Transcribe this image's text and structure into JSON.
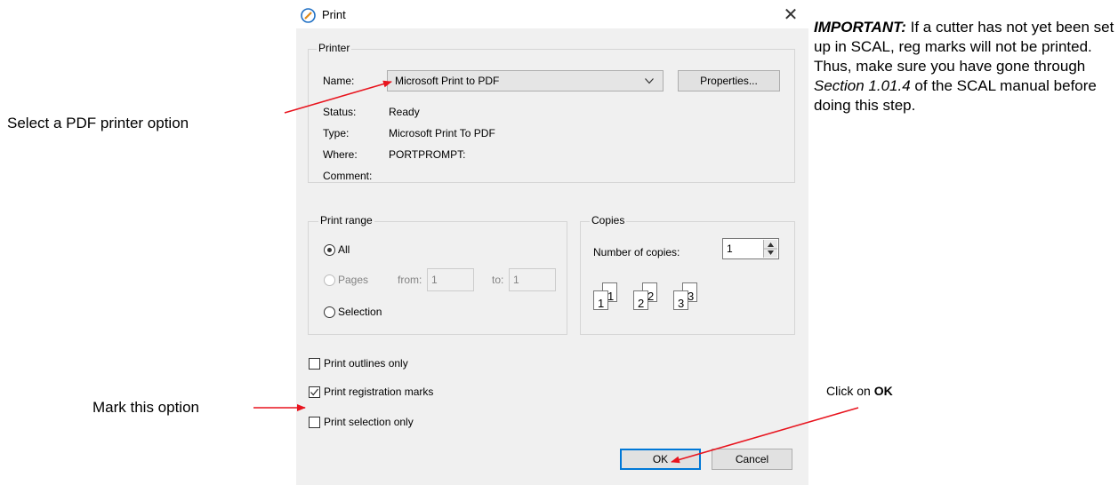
{
  "dialog": {
    "title": "Print",
    "close_glyph": "✕",
    "printer_group": {
      "label": "Printer",
      "name_label": "Name:",
      "name_value": "Microsoft Print to PDF",
      "properties_button": "Properties...",
      "status_label": "Status:",
      "status_value": "Ready",
      "type_label": "Type:",
      "type_value": "Microsoft Print To PDF",
      "where_label": "Where:",
      "where_value": "PORTPROMPT:",
      "comment_label": "Comment:"
    },
    "print_range": {
      "label": "Print range",
      "all": "All",
      "pages": "Pages",
      "from_label": "from:",
      "from_value": "1",
      "to_label": "to:",
      "to_value": "1",
      "selection": "Selection"
    },
    "copies": {
      "label": "Copies",
      "number_label": "Number of copies:",
      "number_value": "1",
      "collate_digits": [
        "1",
        "1",
        "2",
        "2",
        "3",
        "3"
      ]
    },
    "options": {
      "outlines_only": "Print outlines only",
      "registration_marks": "Print registration marks",
      "selection_only": "Print selection only"
    },
    "buttons": {
      "ok": "OK",
      "cancel": "Cancel"
    }
  },
  "annotations": {
    "select_pdf": "Select a PDF printer option",
    "mark_option": "Mark this option",
    "click_ok_prefix": "Click on ",
    "click_ok_bold": "OK",
    "important_bold": "IMPORTANT:",
    "important_part1": " If a cutter has not yet been set up in SCAL, reg marks will not be printed. Thus, make sure you have gone through ",
    "important_italic": "Section 1.01.4",
    "important_part2": " of the SCAL manual before doing this step."
  },
  "colors": {
    "arrow": "#e8141e",
    "accent": "#0078d7"
  }
}
